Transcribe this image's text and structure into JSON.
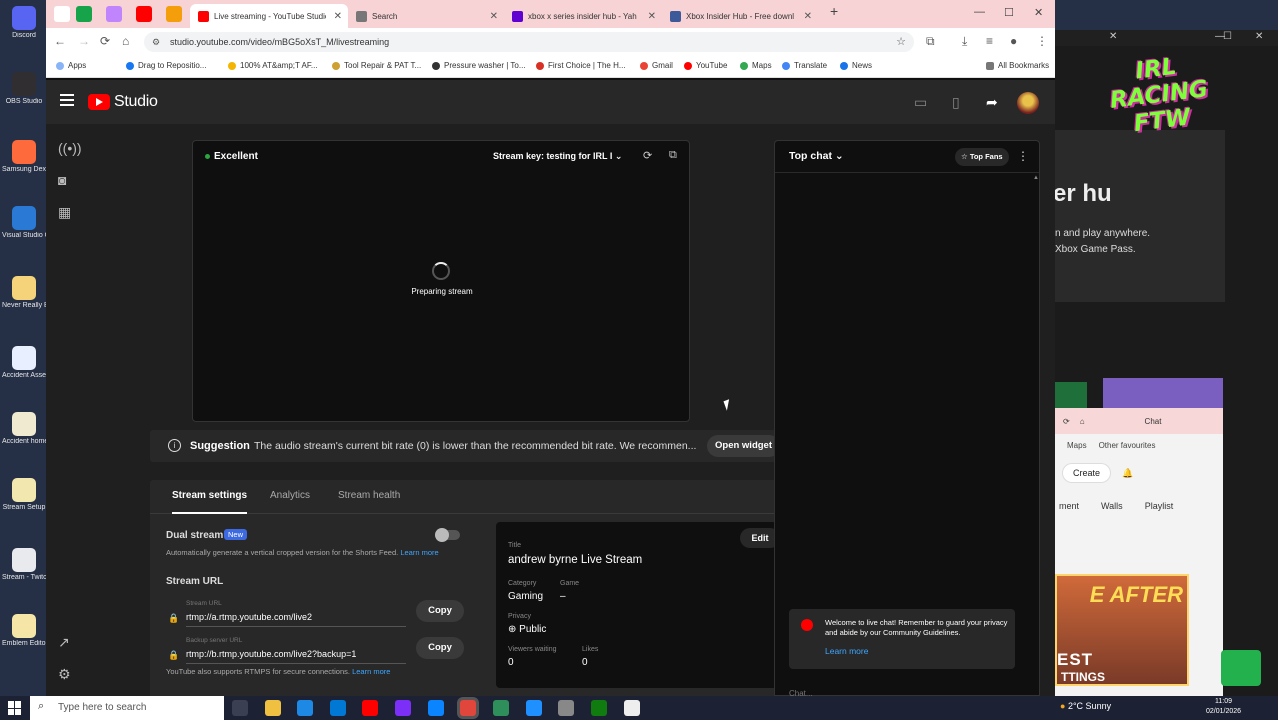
{
  "desktop": {
    "icons": [
      {
        "label": "Discord",
        "color": "#5865f2"
      },
      {
        "label": "OBS Studio",
        "color": "#302e31"
      },
      {
        "label": "Samsung Dex",
        "color": "#ff6a3d"
      },
      {
        "label": "Visual Studio Code",
        "color": "#2a7ad5"
      },
      {
        "label": "Never Really Be",
        "color": "#f4d37a"
      },
      {
        "label": "Accident Assess - F",
        "color": "#e8f0ff"
      },
      {
        "label": "Accident home - R",
        "color": "#f0ead0"
      },
      {
        "label": "Stream Setup",
        "color": "#f3e7b0"
      },
      {
        "label": "Stream - Twitch",
        "color": "#e8eaed"
      },
      {
        "label": "Emblem Editor - R",
        "color": "#f5e6a8"
      }
    ]
  },
  "background_right": {
    "logo_text": "IRL RACING FTW",
    "heading_partial": "er hu",
    "lines": [
      "n and play anywhere.",
      "Xbox Game Pass."
    ],
    "chrome": {
      "tab_chat": "Chat",
      "bookmarks": [
        "Maps",
        "Other favourites"
      ],
      "create_label": "Create",
      "chips": [
        "ment",
        "Walls",
        "Playlist"
      ],
      "thumb_top": "E AFTER",
      "thumb_mid": "EST",
      "thumb_bottom": "TTINGS"
    }
  },
  "browser": {
    "tabs": [
      {
        "title": "Live streaming - YouTube Studio",
        "fav_color": "#ff0000",
        "active": true
      },
      {
        "title": "Search",
        "fav_color": "#777777",
        "active": false
      },
      {
        "title": "xbox x series insider hub - Yah",
        "fav_color": "#6001d2",
        "active": false
      },
      {
        "title": "Xbox Insider Hub - Free downl",
        "fav_color": "#3c5a99",
        "active": false
      }
    ],
    "url": "studio.youtube.com/video/mBG5oXsT_M/livestreaming",
    "bookmarks": [
      {
        "label": "Apps",
        "color": "#8ab4f8"
      },
      {
        "label": "Drag to Repositio...",
        "color": "#1877f2"
      },
      {
        "label": "100% AT&amp;T AF...",
        "color": "#f4b400"
      },
      {
        "label": "Tool Repair & PAT T...",
        "color": "#cfa032"
      },
      {
        "label": "Pressure washer | To...",
        "color": "#333333"
      },
      {
        "label": "First Choice | The H...",
        "color": "#d93025"
      },
      {
        "label": "Gmail",
        "color": "#ea4335"
      },
      {
        "label": "YouTube",
        "color": "#ff0000"
      },
      {
        "label": "Maps",
        "color": "#34a853"
      },
      {
        "label": "Translate",
        "color": "#4285f4"
      },
      {
        "label": "News",
        "color": "#1a73e8"
      }
    ],
    "all_bookmarks": "All Bookmarks"
  },
  "studio": {
    "brand": "Studio",
    "preview": {
      "status": "Excellent",
      "stream_key": "Stream key: testing for IRL I",
      "loading_text": "Preparing stream"
    },
    "suggestion": {
      "title": "Suggestion",
      "text": "The audio stream's current bit rate (0) is lower than the recommended bit rate. We recommen...",
      "button": "Open widget"
    },
    "tabs": [
      "Stream settings",
      "Analytics",
      "Stream health"
    ],
    "settings": {
      "dual_title": "Dual stream",
      "new_badge": "New",
      "dual_desc": "Automatically generate a vertical cropped version for the Shorts Feed.",
      "learn_more": "Learn more",
      "url_title": "Stream URL",
      "stream_url_label": "Stream URL",
      "stream_url": "rtmp://a.rtmp.youtube.com/live2",
      "backup_label": "Backup server URL",
      "backup_url": "rtmp://b.rtmp.youtube.com/live2?backup=1",
      "copy": "Copy",
      "rtmps_note": "YouTube also supports RTMPS for secure connections.",
      "rtmps_link": "Learn more"
    },
    "info": {
      "title_label": "Title",
      "title": "andrew byrne Live Stream",
      "edit": "Edit",
      "category_label": "Category",
      "category": "Gaming",
      "game_label": "Game",
      "game": "–",
      "privacy_label": "Privacy",
      "privacy": "Public",
      "viewers_label": "Viewers waiting",
      "viewers": "0",
      "likes_label": "Likes",
      "likes": "0"
    },
    "chat": {
      "title": "Top chat",
      "top_fans": "Top Fans",
      "welcome": "Welcome to live chat! Remember to guard your privacy and abide by our Community Guidelines.",
      "learn_more": "Learn more",
      "input_placeholder": "Chat..."
    }
  },
  "taskbar": {
    "search_placeholder": "Type here to search",
    "weather": "2°C  Sunny",
    "time": "11:09",
    "date": "02/01/2026"
  }
}
